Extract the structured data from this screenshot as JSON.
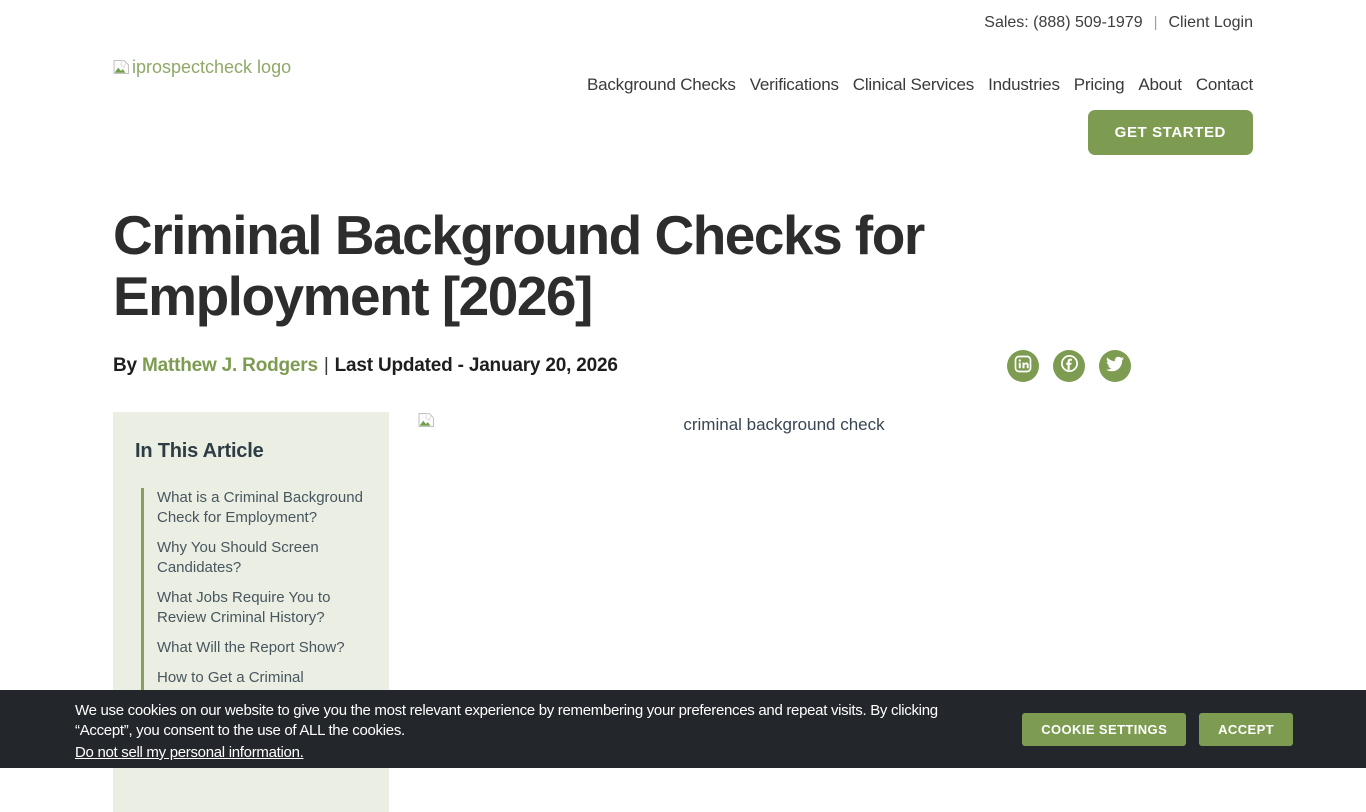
{
  "topbar": {
    "sales_label": "Sales: (888) 509-1979",
    "divider": "|",
    "client_login_label": "Client Login"
  },
  "header": {
    "logo_alt": "iprospectcheck logo",
    "nav": [
      "Background Checks",
      "Verifications",
      "Clinical Services",
      "Industries",
      "Pricing",
      "About",
      "Contact"
    ],
    "cta_label": "GET STARTED"
  },
  "article": {
    "title": "Criminal Background Checks for Employment [2026]",
    "byline": {
      "by": "By ",
      "author": "Matthew J. Rodgers",
      "separator": "|",
      "updated": "Last Updated - January 20, 2026"
    },
    "share_icons": [
      "linkedin",
      "facebook",
      "twitter"
    ],
    "toc": {
      "title": "In This Article",
      "items": [
        "What is a Criminal Background Check for Employment?",
        "Why You Should Screen Candidates?",
        "What Jobs Require You to Review Criminal History?",
        "What Will the Report Show?",
        "How to Get a Criminal"
      ]
    },
    "figure_alt": "criminal background check"
  },
  "cookie_banner": {
    "message": "We use cookies on our website to give you the most relevant experience by remembering your preferences and repeat visits. By clicking “Accept”, you consent to the use of ALL the cookies.",
    "link_label": "Do not sell my personal information.",
    "settings_label": "COOKIE SETTINGS",
    "accept_label": "ACCEPT"
  },
  "colors": {
    "brand_green": "#7d9c51",
    "logo_green": "#8fa968",
    "toc_background": "#ebeee2",
    "cookie_background": "#23262a",
    "heading": "#2d2d2d"
  }
}
